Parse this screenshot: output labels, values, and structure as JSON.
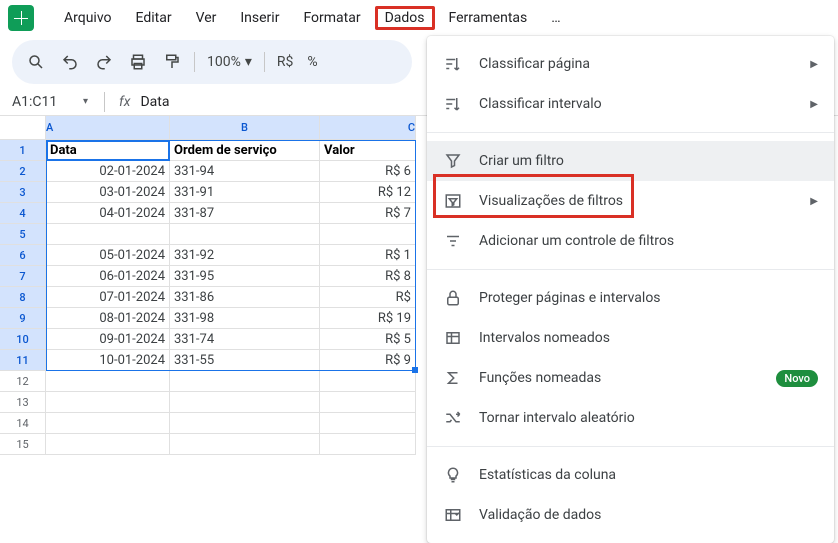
{
  "menubar": {
    "items": [
      "Arquivo",
      "Editar",
      "Ver",
      "Inserir",
      "Formatar",
      "Dados",
      "Ferramentas",
      "…"
    ],
    "highlighted": "Dados"
  },
  "toolbar": {
    "zoom": "100%",
    "currency": "R$",
    "percent": "%"
  },
  "namebox": {
    "ref": "A1:C11",
    "formula_label": "fx",
    "formula_value": "Data"
  },
  "columns": [
    "A",
    "B",
    "C"
  ],
  "headers": {
    "a": "Data",
    "b": "Ordem de serviço",
    "c": "Valor"
  },
  "rows": [
    {
      "a": "02-01-2024",
      "b": "331-94",
      "c": "R$ 6"
    },
    {
      "a": "03-01-2024",
      "b": "331-91",
      "c": "R$ 12"
    },
    {
      "a": "04-01-2024",
      "b": "331-87",
      "c": "R$ 7"
    },
    {
      "a": "",
      "b": "",
      "c": ""
    },
    {
      "a": "05-01-2024",
      "b": "331-92",
      "c": "R$ 1"
    },
    {
      "a": "06-01-2024",
      "b": "331-95",
      "c": "R$ 8"
    },
    {
      "a": "07-01-2024",
      "b": "331-86",
      "c": "R$"
    },
    {
      "a": "08-01-2024",
      "b": "331-98",
      "c": "R$ 19"
    },
    {
      "a": "09-01-2024",
      "b": "331-74",
      "c": "R$ 5"
    },
    {
      "a": "10-01-2024",
      "b": "331-55",
      "c": "R$ 9"
    },
    {
      "a": "",
      "b": "",
      "c": ""
    },
    {
      "a": "",
      "b": "",
      "c": ""
    },
    {
      "a": "",
      "b": "",
      "c": ""
    },
    {
      "a": "",
      "b": "",
      "c": ""
    }
  ],
  "dropdown": {
    "sort_page": "Classificar página",
    "sort_range": "Classificar intervalo",
    "create_filter": "Criar um filtro",
    "filter_views": "Visualizações de filtros",
    "add_filter_control": "Adicionar um controle de filtros",
    "protect": "Proteger páginas e intervalos",
    "named_ranges": "Intervalos nomeados",
    "named_functions": "Funções nomeadas",
    "named_functions_badge": "Novo",
    "randomize": "Tornar intervalo aleatório",
    "column_stats": "Estatísticas da coluna",
    "data_validation": "Validação de dados"
  }
}
